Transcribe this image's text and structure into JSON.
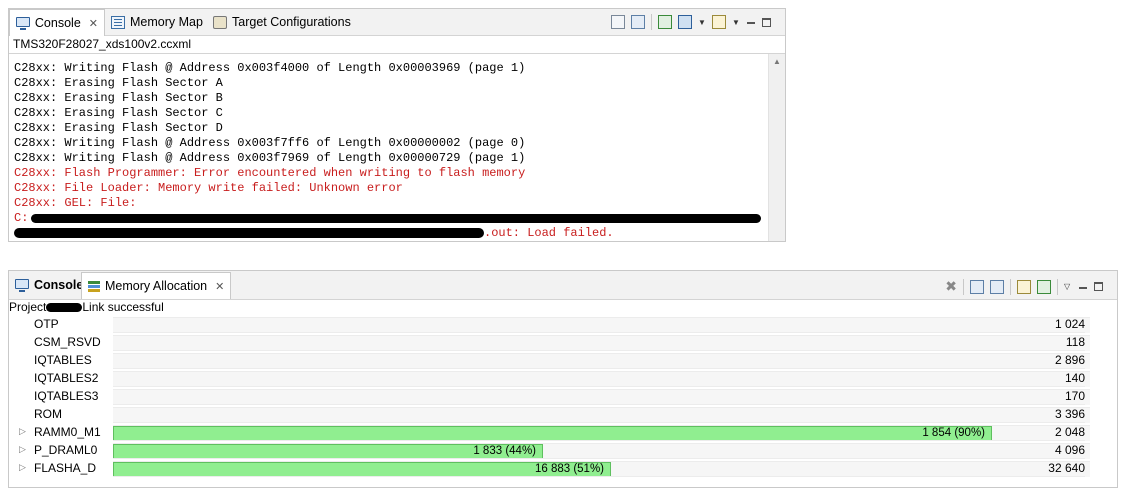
{
  "top_view": {
    "tabs": [
      {
        "label": "Console",
        "icon": "console-icon",
        "active": true
      },
      {
        "label": "Memory Map",
        "icon": "memory-map-icon"
      },
      {
        "label": "Target Configurations",
        "icon": "target-configurations-icon"
      }
    ],
    "config_file": "TMS320F28027_xds100v2.ccxml",
    "lines": [
      {
        "text": "C28xx: Writing Flash @ Address 0x003f4000 of Length 0x00003969 (page 1)",
        "error": false
      },
      {
        "text": "C28xx: Erasing Flash Sector A",
        "error": false
      },
      {
        "text": "C28xx: Erasing Flash Sector B",
        "error": false
      },
      {
        "text": "C28xx: Erasing Flash Sector C",
        "error": false
      },
      {
        "text": "C28xx: Erasing Flash Sector D",
        "error": false
      },
      {
        "text": "C28xx: Writing Flash @ Address 0x003f7ff6 of Length 0x00000002 (page 0)",
        "error": false
      },
      {
        "text": "C28xx: Writing Flash @ Address 0x003f7969 of Length 0x00000729 (page 1)",
        "error": false
      },
      {
        "text": "C28xx: Flash Programmer: Error encountered when writing to flash memory",
        "error": true
      },
      {
        "text": "C28xx: File Loader: Memory write failed: Unknown error",
        "error": true
      },
      {
        "text": "C28xx: GEL: File:",
        "error": true
      },
      {
        "text": "C:",
        "error": true
      },
      {
        "text": ".out: Load failed.",
        "error": true
      }
    ],
    "error_color": "#c81d1d"
  },
  "bottom_view": {
    "tabs": [
      {
        "label": "Console",
        "icon": "console-icon"
      },
      {
        "label": "Memory Allocation",
        "icon": "memory-allocation-icon",
        "active": true
      }
    ],
    "project_prefix": "Project",
    "project_status": "Link successful",
    "bar_color": "#90ee90",
    "rows": [
      {
        "name": "OTP",
        "total": "1 024",
        "expandable": false,
        "used_fraction": null,
        "used_label": ""
      },
      {
        "name": "CSM_RSVD",
        "total": "118",
        "expandable": false,
        "used_fraction": null,
        "used_label": ""
      },
      {
        "name": "IQTABLES",
        "total": "2 896",
        "expandable": false,
        "used_fraction": null,
        "used_label": ""
      },
      {
        "name": "IQTABLES2",
        "total": "140",
        "expandable": false,
        "used_fraction": null,
        "used_label": ""
      },
      {
        "name": "IQTABLES3",
        "total": "170",
        "expandable": false,
        "used_fraction": null,
        "used_label": ""
      },
      {
        "name": "ROM",
        "total": "3 396",
        "expandable": false,
        "used_fraction": null,
        "used_label": ""
      },
      {
        "name": "RAMM0_M1",
        "total": "2 048",
        "expandable": true,
        "used_fraction": 0.9,
        "used_label": "1 854 (90%)"
      },
      {
        "name": "P_DRAML0",
        "total": "4 096",
        "expandable": true,
        "used_fraction": 0.44,
        "used_label": "1 833 (44%)"
      },
      {
        "name": "FLASHA_D",
        "total": "32 640",
        "expandable": true,
        "used_fraction": 0.51,
        "used_label": "16 883 (51%)"
      }
    ]
  }
}
